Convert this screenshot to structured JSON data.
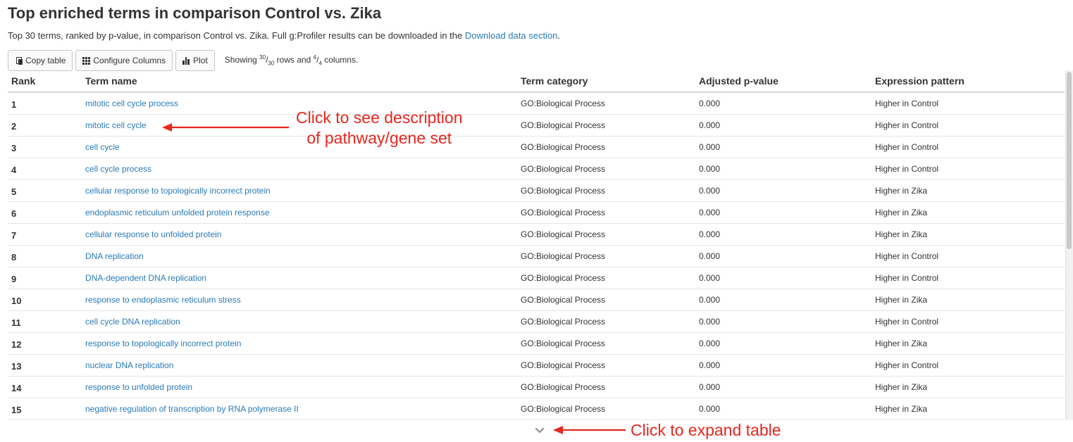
{
  "page": {
    "title": "Top enriched terms in comparison Control vs. Zika",
    "subtitle_text": "Top 30 terms, ranked by p-value, in comparison Control vs. Zika. Full g:Profiler results can be downloaded in the ",
    "subtitle_link": "Download data section",
    "subtitle_end": "."
  },
  "toolbar": {
    "copy_label": "Copy table",
    "configure_label": "Configure Columns",
    "plot_label": "Plot",
    "showing_prefix": "Showing ",
    "rows_shown": "30",
    "rows_total": "30",
    "rows_mid": " rows and ",
    "cols_shown": "4",
    "cols_total": "4",
    "showing_suffix": " columns."
  },
  "table": {
    "headers": [
      "Rank",
      "Term name",
      "Term category",
      "Adjusted p-value",
      "Expression pattern"
    ],
    "rows": [
      [
        "1",
        "mitotic cell cycle process",
        "GO:Biological Process",
        "0.000",
        "Higher in Control"
      ],
      [
        "2",
        "mitotic cell cycle",
        "GO:Biological Process",
        "0.000",
        "Higher in Control"
      ],
      [
        "3",
        "cell cycle",
        "GO:Biological Process",
        "0.000",
        "Higher in Control"
      ],
      [
        "4",
        "cell cycle process",
        "GO:Biological Process",
        "0.000",
        "Higher in Control"
      ],
      [
        "5",
        "cellular response to topologically incorrect protein",
        "GO:Biological Process",
        "0.000",
        "Higher in Zika"
      ],
      [
        "6",
        "endoplasmic reticulum unfolded protein response",
        "GO:Biological Process",
        "0.000",
        "Higher in Zika"
      ],
      [
        "7",
        "cellular response to unfolded protein",
        "GO:Biological Process",
        "0.000",
        "Higher in Zika"
      ],
      [
        "8",
        "DNA replication",
        "GO:Biological Process",
        "0.000",
        "Higher in Control"
      ],
      [
        "9",
        "DNA-dependent DNA replication",
        "GO:Biological Process",
        "0.000",
        "Higher in Control"
      ],
      [
        "10",
        "response to endoplasmic reticulum stress",
        "GO:Biological Process",
        "0.000",
        "Higher in Zika"
      ],
      [
        "11",
        "cell cycle DNA replication",
        "GO:Biological Process",
        "0.000",
        "Higher in Control"
      ],
      [
        "12",
        "response to topologically incorrect protein",
        "GO:Biological Process",
        "0.000",
        "Higher in Zika"
      ],
      [
        "13",
        "nuclear DNA replication",
        "GO:Biological Process",
        "0.000",
        "Higher in Control"
      ],
      [
        "14",
        "response to unfolded protein",
        "GO:Biological Process",
        "0.000",
        "Higher in Zika"
      ],
      [
        "15",
        "negative regulation of transcription by RNA polymerase II",
        "GO:Biological Process",
        "0.000",
        "Higher in Zika"
      ]
    ]
  },
  "annotations": {
    "term_line1": "Click to see description",
    "term_line2": "of pathway/gene set",
    "expand": "Click to expand table"
  },
  "colors": {
    "link": "#2a7ab8",
    "annotation": "#e8271e"
  }
}
